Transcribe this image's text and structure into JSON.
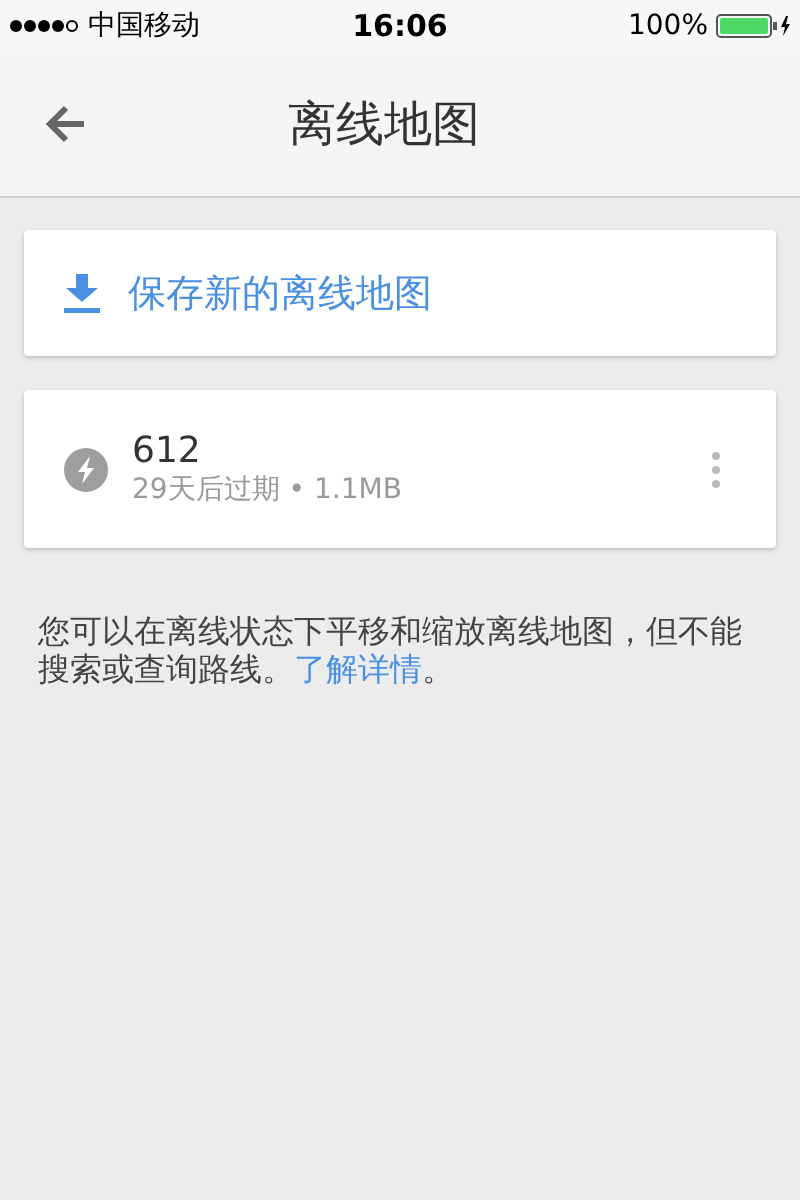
{
  "status_bar": {
    "carrier": "中国移动",
    "time": "16:06",
    "battery": "100%"
  },
  "header": {
    "title": "离线地图"
  },
  "save_action": {
    "label": "保存新的离线地图"
  },
  "maps": [
    {
      "name": "612",
      "detail": "29天后过期 • 1.1MB"
    }
  ],
  "note": {
    "text": "您可以在离线状态下平移和缩放离线地图，但不能搜索或查询路线。",
    "link": "了解详情",
    "suffix": "。"
  }
}
